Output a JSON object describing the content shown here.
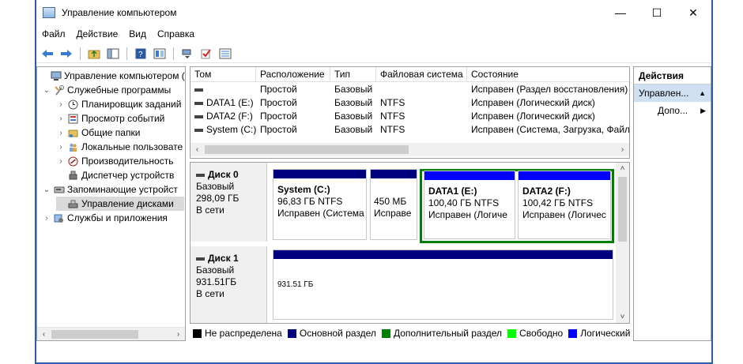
{
  "window": {
    "title": "Управление компьютером",
    "controls": {
      "minimize": "—",
      "maximize": "☐",
      "close": "✕"
    }
  },
  "menu": [
    "Файл",
    "Действие",
    "Вид",
    "Справка"
  ],
  "tree": {
    "items": [
      {
        "label": "Управление компьютером (л",
        "chev": "",
        "icon": "computer-icon"
      },
      {
        "label": "Служебные программы",
        "chev": "⌄",
        "icon": "tools-icon"
      },
      {
        "label": "Планировщик заданий",
        "chev": "›",
        "icon": "clock-icon"
      },
      {
        "label": "Просмотр событий",
        "chev": "›",
        "icon": "event-viewer-icon"
      },
      {
        "label": "Общие папки",
        "chev": "›",
        "icon": "shared-folder-icon"
      },
      {
        "label": "Локальные пользовате",
        "chev": "›",
        "icon": "users-icon"
      },
      {
        "label": "Производительность",
        "chev": "›",
        "icon": "performance-icon"
      },
      {
        "label": "Диспетчер устройств",
        "chev": "",
        "icon": "device-manager-icon"
      },
      {
        "label": "Запоминающие устройст",
        "chev": "⌄",
        "icon": "storage-icon"
      },
      {
        "label": "Управление дисками",
        "chev": "",
        "icon": "disk-management-icon"
      },
      {
        "label": "Службы и приложения",
        "chev": "›",
        "icon": "services-icon"
      }
    ],
    "scroll": {
      "left": "‹",
      "right": "›"
    }
  },
  "volumes": {
    "columns": [
      "Том",
      "Расположение",
      "Тип",
      "Файловая система",
      "Состояние"
    ],
    "rows": [
      {
        "name": "",
        "layout": "Простой",
        "type": "Базовый",
        "fs": "",
        "status": "Исправен (Раздел восстановления)"
      },
      {
        "name": "DATA1 (E:)",
        "layout": "Простой",
        "type": "Базовый",
        "fs": "NTFS",
        "status": "Исправен (Логический диск)"
      },
      {
        "name": "DATA2 (F:)",
        "layout": "Простой",
        "type": "Базовый",
        "fs": "NTFS",
        "status": "Исправен (Логический диск)"
      },
      {
        "name": "System (C:)",
        "layout": "Простой",
        "type": "Базовый",
        "fs": "NTFS",
        "status": "Исправен (Система, Загрузка, Файл"
      }
    ],
    "scroll": {
      "left": "‹",
      "right": "›"
    }
  },
  "disks": [
    {
      "name": "Диск 0",
      "type": "Базовый",
      "size": "298,09 ГБ",
      "state": "В сети",
      "partitions": [
        {
          "title": "System  (C:)",
          "size": "96,83 ГБ NTFS",
          "status": "Исправен (Система"
        },
        {
          "title": "",
          "size": "450 МБ",
          "status": "Исправе"
        },
        {
          "title": "DATA1  (E:)",
          "size": "100,40 ГБ NTFS",
          "status": "Исправен (Логиче"
        },
        {
          "title": "DATA2  (F:)",
          "size": "100,42 ГБ NTFS",
          "status": "Исправен (Логичес"
        }
      ]
    },
    {
      "name": "Диск 1",
      "type": "Базовый",
      "size": "931.51ГБ",
      "state": "В сети",
      "partitions": [
        {
          "title": "",
          "size": "931.51 ГБ",
          "status": ""
        }
      ]
    }
  ],
  "disk_scroll": {
    "up": "˄",
    "down": "˅"
  },
  "legend": [
    {
      "label": "Не распределена",
      "color": "#000000"
    },
    {
      "label": "Основной раздел",
      "color": "#00007f"
    },
    {
      "label": "Дополнительный раздел",
      "color": "#008000"
    },
    {
      "label": "Свободно",
      "color": "#00ff00"
    },
    {
      "label": "Логический",
      "color": "#0000ff"
    }
  ],
  "actions": {
    "title": "Действия",
    "section": "Управлен...",
    "section_arrow": "▲",
    "more": "Допо...",
    "more_arrow": "▶"
  }
}
